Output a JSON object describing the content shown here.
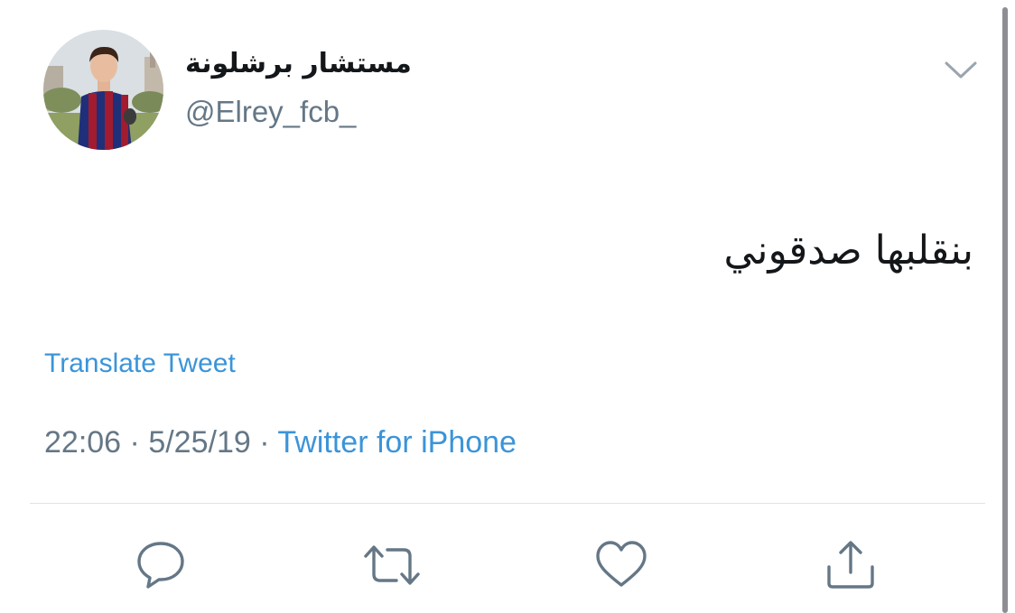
{
  "author": {
    "display_name": "مستشار برشلونة",
    "handle": "@Elrey_fcb_"
  },
  "tweet": {
    "text": "بنقلبها صدقوني",
    "translate_label": "Translate Tweet"
  },
  "meta": {
    "time": "22:06",
    "separator": "·",
    "date": "5/25/19",
    "source": "Twitter for iPhone"
  },
  "actions": [
    {
      "name": "reply",
      "icon": "reply-icon"
    },
    {
      "name": "retweet",
      "icon": "retweet-icon"
    },
    {
      "name": "like",
      "icon": "heart-icon"
    },
    {
      "name": "share",
      "icon": "share-icon"
    }
  ],
  "colors": {
    "text": "#14171a",
    "secondary": "#657786",
    "link": "#3b94d9",
    "icon": "#657786",
    "divider": "#dfe3e6"
  }
}
